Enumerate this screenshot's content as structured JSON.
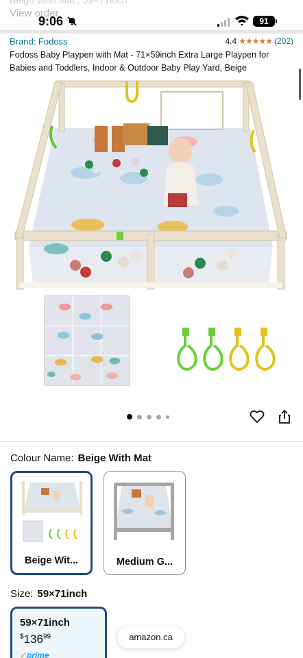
{
  "status_bar": {
    "time": "9:06",
    "battery": "91",
    "ghost_title": "Beige With Mat , 59×71inch",
    "ghost_link": "View order"
  },
  "product": {
    "brand": "Brand: Fodoss",
    "rating": "4.4",
    "rating_stars": "★★★★★",
    "rating_count": "(202)",
    "title": "Fodoss Baby Playpen with Mat - 71×59inch Extra Large Playpen for Babies and Toddlers, Indoor & Outdoor Baby Play Yard, Beige"
  },
  "gallery": {
    "page_count": 5,
    "current_page": 1
  },
  "colour": {
    "label": "Colour Name:",
    "value": "Beige With Mat",
    "options": [
      {
        "label": "Beige Wit...",
        "selected": true
      },
      {
        "label": "Medium G...",
        "selected": false
      }
    ]
  },
  "size": {
    "label": "Size:",
    "value": "59×71inch",
    "card": {
      "name": "59×71inch",
      "price_symbol": "$",
      "price_whole": "136",
      "price_fraction": "99",
      "prime": "prime"
    }
  },
  "url_pill": "amazon.ca",
  "colors": {
    "link": "#007185",
    "star": "#de7921",
    "selected_border": "#1f4b7b",
    "prime": "#1a98ff"
  }
}
